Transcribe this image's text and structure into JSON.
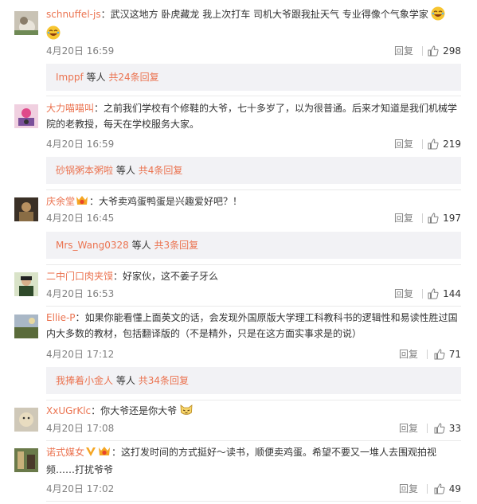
{
  "comments": [
    {
      "user": "schnuffel-js",
      "text_line1": "武汉这地方  卧虎藏龙   我上次打车 司机大爷跟我扯天气    专业得像个气象学家",
      "text_line2": "",
      "date": "4月20日 16:59",
      "reply_label": "回复",
      "likes": "298",
      "sub": {
        "user": "Imppf",
        "mid": "等人",
        "count": "共24条回复"
      }
    },
    {
      "user": "大力喵喵叫",
      "text_line1": "之前我们学校有个修鞋的大爷，七十多岁了，以为很普通。后来才知道是我们机械学",
      "text_line2": "院的老教授，每天在学校服务大家。",
      "date": "4月20日 16:59",
      "reply_label": "回复",
      "likes": "219",
      "sub": {
        "user": "砂锅粥本粥啦",
        "mid": "等人",
        "count": "共4条回复"
      }
    },
    {
      "user": "庆余堂",
      "text_line1": "大爷卖鸡蛋鸭蛋是兴趣爱好吧？！",
      "text_line2": "",
      "date": "4月20日 16:45",
      "reply_label": "回复",
      "likes": "197",
      "sub": {
        "user": "Mrs_Wang0328",
        "mid": "等人",
        "count": "共3条回复"
      }
    },
    {
      "user": "二中门口肉夹馍",
      "text_line1": "好家伙，这不姜子牙么",
      "text_line2": "",
      "date": "4月20日 16:53",
      "reply_label": "回复",
      "likes": "144"
    },
    {
      "user": "Ellie-P",
      "text_line1": "如果你能看懂上面英文的话，会发现外国原版大学理工科教科书的逻辑性和易读性胜过国",
      "text_line2": "内大多数的教材，包括翻译版的（不是精外，只是在这方面实事求是的说）",
      "date": "4月20日 17:12",
      "reply_label": "回复",
      "likes": "71",
      "sub": {
        "user": "我捧着小金人",
        "mid": "等人",
        "count": "共34条回复"
      }
    },
    {
      "user": "XxUGrKlc",
      "text_line1": "你大爷还是你大爷",
      "text_line2": "",
      "date": "4月20日 17:08",
      "reply_label": "回复",
      "likes": "33"
    },
    {
      "user": "诺式媒女",
      "text_line1": "这打发时间的方式挺好～读书，顺便卖鸡蛋。希望不要又一堆人去围观拍视",
      "text_line2": "频……打扰爷爷",
      "date": "4月20日 17:02",
      "reply_label": "回复",
      "likes": "49"
    }
  ],
  "colors": {
    "link": "#eb7350",
    "text": "#333333",
    "meta": "#808080",
    "subbox_bg": "#f2f2f5"
  }
}
